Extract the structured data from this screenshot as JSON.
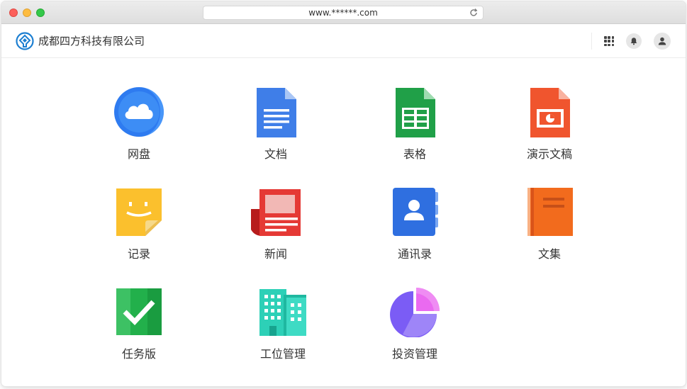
{
  "browser": {
    "url": "www.******.com"
  },
  "header": {
    "company_name": "成都四方科技有限公司",
    "icons": [
      "logo-icon",
      "apps-grid-icon",
      "bell-icon",
      "user-icon"
    ]
  },
  "apps": [
    {
      "label": "网盘",
      "icon": "cloud-drive-icon"
    },
    {
      "label": "文档",
      "icon": "docs-icon"
    },
    {
      "label": "表格",
      "icon": "sheets-icon"
    },
    {
      "label": "演示文稿",
      "icon": "slides-icon"
    },
    {
      "label": "记录",
      "icon": "notes-icon"
    },
    {
      "label": "新闻",
      "icon": "news-icon"
    },
    {
      "label": "通讯录",
      "icon": "contacts-icon"
    },
    {
      "label": "文集",
      "icon": "collection-icon"
    },
    {
      "label": "任务版",
      "icon": "tasks-icon"
    },
    {
      "label": "工位管理",
      "icon": "workstation-icon"
    },
    {
      "label": "投资管理",
      "icon": "investment-icon"
    }
  ],
  "colors": {
    "brand_blue": "#1d7fd1",
    "docs_blue": "#3f7ee8",
    "sheets_green": "#20a048",
    "slides_orange": "#f0552e",
    "notes_yellow": "#fbc02d",
    "news_red": "#e53935",
    "contacts_blue": "#2f6fe0",
    "collection_orange": "#f26b1d",
    "tasks_green": "#22b04b",
    "building_teal": "#2dd0b7",
    "pie_purple": "#7b5cf5"
  }
}
